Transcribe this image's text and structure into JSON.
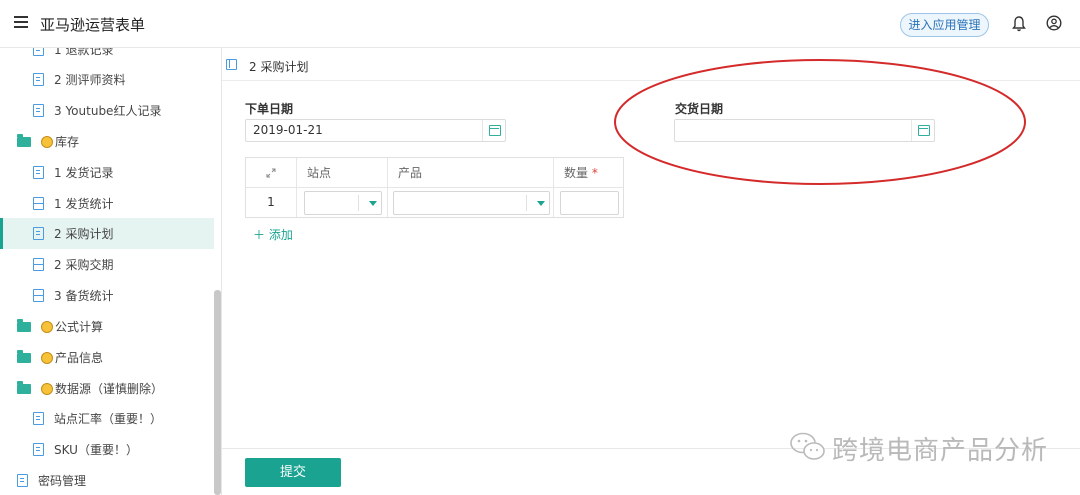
{
  "header": {
    "title": "亚马逊运营表单",
    "manage_label": "进入应用管理"
  },
  "sidebar": {
    "items": [
      {
        "label": "1 退款记录",
        "type": "doc"
      },
      {
        "label": "2 测评师资料",
        "type": "doc"
      },
      {
        "label": "3 Youtube红人记录",
        "type": "doc"
      },
      {
        "label": "库存",
        "type": "folder"
      },
      {
        "label": "1 发货记录",
        "type": "doc"
      },
      {
        "label": "1 发货统计",
        "type": "sheet"
      },
      {
        "label": "2 采购计划",
        "type": "doc",
        "active": true
      },
      {
        "label": "2 采购交期",
        "type": "sheet"
      },
      {
        "label": "3 备货统计",
        "type": "sheet"
      },
      {
        "label": "公式计算",
        "type": "folder"
      },
      {
        "label": "产品信息",
        "type": "folder"
      },
      {
        "label": "数据源（谨慎删除）",
        "type": "folder"
      },
      {
        "label": "站点汇率（重要！）",
        "type": "doc"
      },
      {
        "label": "SKU（重要！）",
        "type": "doc"
      },
      {
        "label": "密码管理",
        "type": "doc"
      }
    ]
  },
  "breadcrumb": "2 采购计划",
  "form": {
    "order_date_label": "下单日期",
    "order_date_value": "2019-01-21",
    "delivery_date_label": "交货日期",
    "delivery_date_value": "",
    "table": {
      "columns": [
        "站点",
        "产品",
        "数量"
      ],
      "required_mark": "*",
      "rows": [
        {
          "index": "1",
          "site": "",
          "product": "",
          "quantity": ""
        }
      ]
    },
    "add_label": "添加",
    "submit_label": "提交"
  },
  "watermark": "跨境电商产品分析",
  "colors": {
    "accent": "#19a390",
    "annotation": "#d42a2a"
  }
}
